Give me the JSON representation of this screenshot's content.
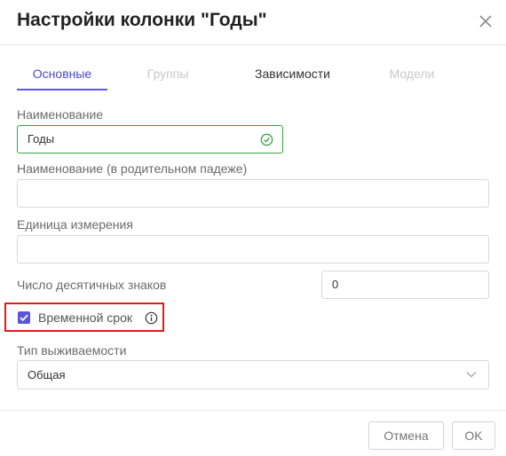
{
  "dialog": {
    "title": "Настройки колонки \"Годы\"",
    "close_icon": "close-icon"
  },
  "tabs": [
    {
      "label": "Основные",
      "state": "active"
    },
    {
      "label": "Группы",
      "state": "disabled"
    },
    {
      "label": "Зависимости",
      "state": "normal"
    },
    {
      "label": "Модели",
      "state": "disabled"
    }
  ],
  "form": {
    "name": {
      "label": "Наименование",
      "value": "Годы",
      "status_icon": "check-circle-icon"
    },
    "name_genitive": {
      "label": "Наименование (в родительном падеже)",
      "value": ""
    },
    "unit": {
      "label": "Единица измерения",
      "value": ""
    },
    "decimals": {
      "label": "Число десятичных знаков",
      "value": "0"
    },
    "time_period": {
      "label": "Временной срок",
      "checked": true,
      "info_icon": "info-icon"
    },
    "survival_type": {
      "label": "Тип выживаемости",
      "value": "Общая",
      "arrow_icon": "chevron-down-icon"
    }
  },
  "footer": {
    "cancel_label": "Отмена",
    "ok_label": "OK"
  },
  "colors": {
    "accent": "#5b5be0",
    "valid": "#35a843",
    "highlight": "#e21b1b"
  }
}
